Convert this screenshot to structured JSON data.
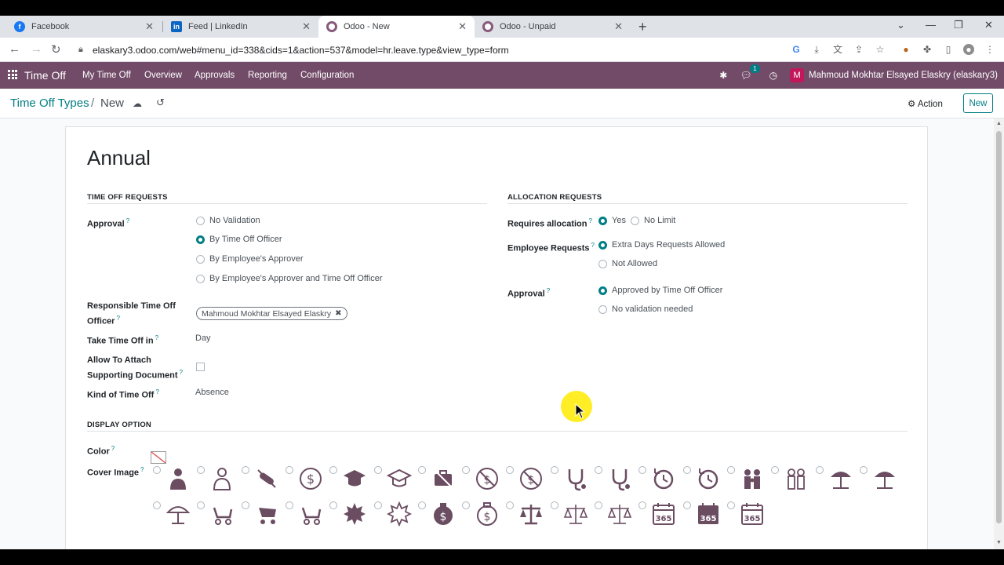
{
  "browser": {
    "tabs": [
      {
        "title": "Facebook",
        "icon": "facebook-icon",
        "color": "#1877f2"
      },
      {
        "title": "Feed | LinkedIn",
        "icon": "linkedin-icon",
        "color": "#0a66c2"
      },
      {
        "title": "Odoo - New",
        "icon": "odoo-icon",
        "color": "#875a7b"
      },
      {
        "title": "Odoo - Unpaid",
        "icon": "odoo-icon",
        "color": "#875a7b"
      }
    ],
    "url": "elaskary3.odoo.com/web#menu_id=338&cids=1&action=537&model=hr.leave.type&view_type=form"
  },
  "navbar": {
    "app": "Time Off",
    "menus": [
      "My Time Off",
      "Overview",
      "Approvals",
      "Reporting",
      "Configuration"
    ],
    "messages_badge": "1",
    "avatar_letter": "M",
    "user": "Mahmoud Mokhtar Elsayed Elaskry (elaskary3)"
  },
  "control": {
    "breadcrumb_parent": "Time Off Types",
    "breadcrumb_sep": "/",
    "breadcrumb_current": "New",
    "action_label": "Action",
    "new_label": "New"
  },
  "form": {
    "name": "Annual",
    "time_off_requests": {
      "title": "TIME OFF REQUESTS",
      "approval_label": "Approval",
      "approval_options": [
        "No Validation",
        "By Time Off Officer",
        "By Employee's Approver",
        "By Employee's Approver and Time Off Officer"
      ],
      "approval_selected": 1,
      "responsible_label_1": "Responsible Time Off",
      "responsible_label_2": "Officer",
      "responsible_tag": "Mahmoud Mokhtar Elsayed Elaskry",
      "take_in_label": "Take Time Off in",
      "take_in_value": "Day",
      "attach_label_1": "Allow To Attach",
      "attach_label_2": "Supporting Document",
      "kind_label": "Kind of Time Off",
      "kind_value": "Absence"
    },
    "allocation_requests": {
      "title": "ALLOCATION REQUESTS",
      "requires_label": "Requires allocation",
      "requires_options": [
        "Yes",
        "No Limit"
      ],
      "requires_selected": 0,
      "employee_label": "Employee Requests",
      "employee_options": [
        "Extra Days Requests Allowed",
        "Not Allowed"
      ],
      "employee_selected": 0,
      "approval_label": "Approval",
      "approval_options": [
        "Approved by Time Off Officer",
        "No validation needed"
      ],
      "approval_selected": 0
    },
    "display_option": {
      "title": "DISPLAY OPTION",
      "color_label": "Color",
      "cover_label": "Cover Image",
      "cover_icons_row1": [
        "user-sling-icon",
        "user-sling-outline-icon",
        "no-medicine-icon",
        "coin-dollar-icon",
        "graduation-cap-icon",
        "graduation-cap-outline-icon",
        "no-briefcase-icon",
        "no-dollar-icon",
        "no-cash-icon",
        "stethoscope-icon",
        "stethoscope-outline-icon",
        "rotate-clock-icon",
        "rotate-clock-outline-icon",
        "family-icon",
        "family-outline-icon",
        "beach-umbrella-icon",
        "beach-umbrella-filled-icon"
      ],
      "cover_icons_row2": [
        "umbrella-sun-icon",
        "baby-stroller-icon",
        "baby-stroller-filled-icon",
        "baby-stroller-outline-icon",
        "badge-burst-icon",
        "badge-burst-outline-icon",
        "money-bag-icon",
        "money-bag-outline-icon",
        "scale-icon",
        "scale-outline-icon",
        "scale-thin-icon",
        "calendar-365-icon",
        "calendar-365-filled-icon",
        "calendar-365-outline-icon"
      ]
    }
  },
  "colors": {
    "brand": "#714b67",
    "accent": "#017e84",
    "icon": "#6b4d62"
  }
}
